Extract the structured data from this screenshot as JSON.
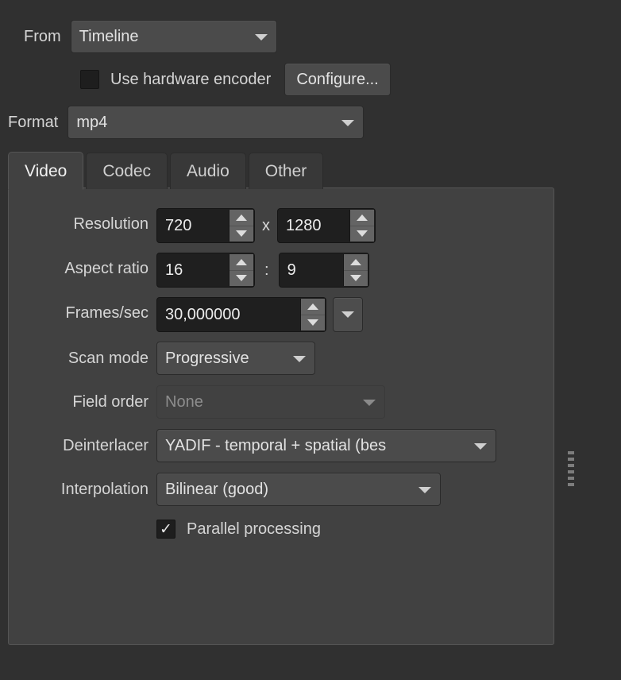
{
  "export_form": {
    "from": {
      "label": "From",
      "value": "Timeline"
    },
    "hardware_encoder": {
      "label": "Use hardware encoder",
      "checked": false,
      "checkmark": "✓",
      "configure_button": "Configure..."
    },
    "format": {
      "label": "Format",
      "value": "mp4"
    }
  },
  "tabs": [
    {
      "label": "Video",
      "active": true
    },
    {
      "label": "Codec",
      "active": false
    },
    {
      "label": "Audio",
      "active": false
    },
    {
      "label": "Other",
      "active": false
    }
  ],
  "video_tab": {
    "resolution": {
      "label": "Resolution",
      "width": "720",
      "separator": "x",
      "height": "1280"
    },
    "aspect_ratio": {
      "label": "Aspect ratio",
      "numerator": "16",
      "separator": ":",
      "denominator": "9"
    },
    "frames_per_sec": {
      "label": "Frames/sec",
      "value": "30,000000"
    },
    "scan_mode": {
      "label": "Scan mode",
      "value": "Progressive"
    },
    "field_order": {
      "label": "Field order",
      "value": "None",
      "disabled": true
    },
    "deinterlacer": {
      "label": "Deinterlacer",
      "value": "YADIF - temporal + spatial (bes"
    },
    "interpolation": {
      "label": "Interpolation",
      "value": "Bilinear (good)"
    },
    "parallel_processing": {
      "label": "Parallel processing",
      "checked": true,
      "checkmark": "✓"
    }
  },
  "colors": {
    "window_background": "#303030",
    "panel_background": "#414141",
    "control_background": "#4b4b4b",
    "field_background": "#1f1f1f",
    "text": "#d5d5d5",
    "text_disabled": "#8d8d8d",
    "panel_border": "#555555"
  }
}
